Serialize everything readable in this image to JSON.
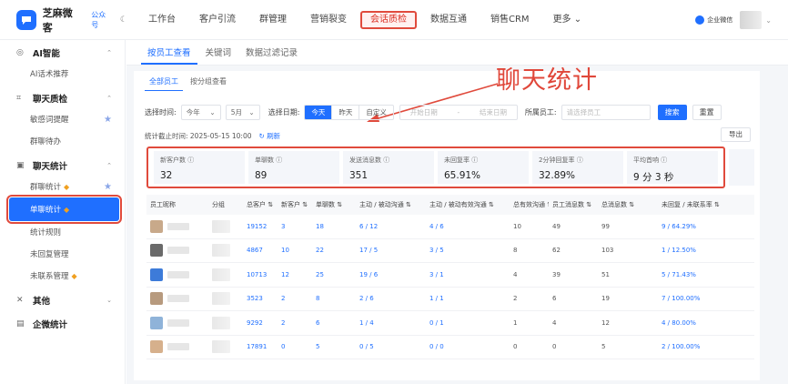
{
  "topbar": {
    "app_name": "芝麻微客",
    "account_type": "公众号",
    "theme_icon": "moon-icon",
    "nav": [
      "工作台",
      "客户引流",
      "群管理",
      "营销裂变",
      "会话质检",
      "数据互通",
      "销售CRM",
      "更多"
    ],
    "active_nav": "会话质检",
    "badge": "企业微信"
  },
  "sidebar": {
    "groups": [
      {
        "icon": "target-icon",
        "label": "AI智能",
        "items": [
          {
            "label": "AI话术推荐"
          }
        ]
      },
      {
        "icon": "chat-check-icon",
        "label": "聊天质检",
        "items": [
          {
            "label": "敏感词提醒",
            "star": true
          },
          {
            "label": "群聊待办"
          }
        ]
      },
      {
        "icon": "stats-icon",
        "label": "聊天统计",
        "items": [
          {
            "label": "群聊统计",
            "gem": true,
            "star": true
          },
          {
            "label": "单聊统计",
            "gem": true,
            "active": true
          },
          {
            "label": "统计规则"
          },
          {
            "label": "未回复管理"
          },
          {
            "label": "未联系管理",
            "gem": true
          }
        ]
      },
      {
        "icon": "other-icon",
        "label": "其他",
        "items": []
      },
      {
        "icon": "enterprise-stats-icon",
        "label": "企微统计",
        "items": []
      }
    ]
  },
  "main": {
    "tabs": [
      "按员工查看",
      "关键词",
      "数据过滤记录"
    ],
    "subtabs": [
      "全部员工",
      "按分组查看"
    ],
    "annotation": "聊天统计",
    "filters": {
      "time_label": "选择时间:",
      "year": "今年",
      "month": "5月",
      "date_label": "选择日期:",
      "date_options": [
        "今天",
        "昨天",
        "自定义"
      ],
      "start_placeholder": "开始日期",
      "end_placeholder": "结束日期",
      "employee_label": "所属员工:",
      "employee_placeholder": "请选择员工",
      "search": "搜索",
      "reset": "重置"
    },
    "deadline": "统计截止时间: 2025-05-15 10:00",
    "refresh": "刷新",
    "export": "导出",
    "stats": [
      {
        "label": "新客户数",
        "value": "32"
      },
      {
        "label": "单聊数",
        "value": "89"
      },
      {
        "label": "发送消息数",
        "value": "351"
      },
      {
        "label": "未回复率",
        "value": "65.91%"
      },
      {
        "label": "2分钟回复率",
        "value": "32.89%"
      },
      {
        "label": "平均首响",
        "value": "9 分 3 秒"
      }
    ],
    "table": {
      "headers": [
        "员工昵称",
        "分组",
        "总客户",
        "新客户",
        "单聊数",
        "主动 / 被动沟通",
        "主动 / 被动有效沟通",
        "总有效沟通",
        "员工消息数",
        "总消息数",
        "未回复 / 未联系率"
      ],
      "rows": [
        [
          "19152",
          "3",
          "18",
          "6 / 12",
          "4 / 6",
          "10",
          "49",
          "99",
          "9 / 64.29%"
        ],
        [
          "4867",
          "10",
          "22",
          "17 / 5",
          "3 / 5",
          "8",
          "62",
          "103",
          "1 / 12.50%"
        ],
        [
          "10713",
          "12",
          "25",
          "19 / 6",
          "3 / 1",
          "4",
          "39",
          "51",
          "5 / 71.43%"
        ],
        [
          "3523",
          "2",
          "8",
          "2 / 6",
          "1 / 1",
          "2",
          "6",
          "19",
          "7 / 100.00%"
        ],
        [
          "9292",
          "2",
          "6",
          "1 / 4",
          "0 / 1",
          "1",
          "4",
          "12",
          "4 / 80.00%"
        ],
        [
          "17891",
          "0",
          "5",
          "0 / 5",
          "0 / 0",
          "0",
          "0",
          "5",
          "2 / 100.00%"
        ]
      ]
    }
  },
  "colors": {
    "accent": "#1f6fff",
    "highlight": "#e04a3c",
    "gem": "#f0a020"
  }
}
